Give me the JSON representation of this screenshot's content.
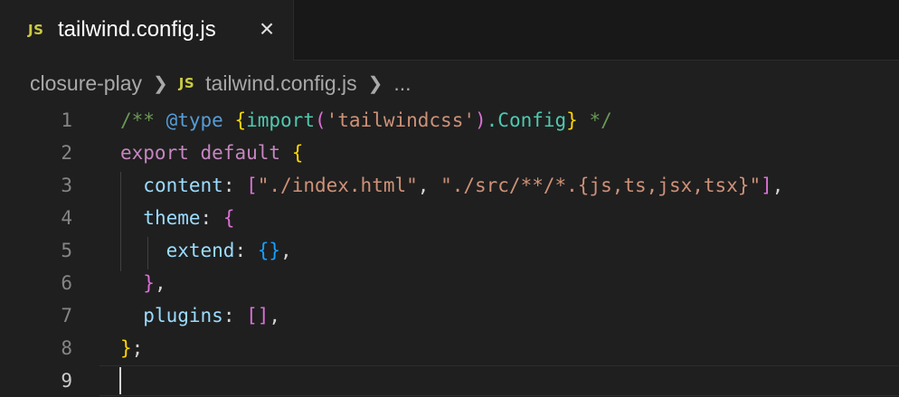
{
  "tab": {
    "icon": "JS",
    "label": "tailwind.config.js",
    "close": "×"
  },
  "breadcrumb": {
    "folder": "closure-play",
    "file_icon": "JS",
    "file": "tailwind.config.js",
    "more": "..."
  },
  "editor": {
    "line_numbers": [
      "1",
      "2",
      "3",
      "4",
      "5",
      "6",
      "7",
      "8",
      "9"
    ],
    "lines": [
      [
        {
          "t": "/** ",
          "c": "comment"
        },
        {
          "t": "@type",
          "c": "tag"
        },
        {
          "t": " ",
          "c": "comment"
        },
        {
          "t": "{",
          "c": "br1"
        },
        {
          "t": "import",
          "c": "type"
        },
        {
          "t": "(",
          "c": "br2"
        },
        {
          "t": "'tailwindcss'",
          "c": "str"
        },
        {
          "t": ")",
          "c": "br2"
        },
        {
          "t": ".Config",
          "c": "type"
        },
        {
          "t": "}",
          "c": "br1"
        },
        {
          "t": " */",
          "c": "comment"
        }
      ],
      [
        {
          "t": "export",
          "c": "kw"
        },
        {
          "t": " ",
          "c": "punc"
        },
        {
          "t": "default",
          "c": "kw"
        },
        {
          "t": " ",
          "c": "punc"
        },
        {
          "t": "{",
          "c": "br1"
        }
      ],
      [
        {
          "t": "  ",
          "c": "punc"
        },
        {
          "t": "content",
          "c": "prop"
        },
        {
          "t": ": ",
          "c": "punc"
        },
        {
          "t": "[",
          "c": "br2"
        },
        {
          "t": "\"./index.html\"",
          "c": "str"
        },
        {
          "t": ", ",
          "c": "punc"
        },
        {
          "t": "\"./src/**/*.{js,ts,jsx,tsx}\"",
          "c": "str"
        },
        {
          "t": "]",
          "c": "br2"
        },
        {
          "t": ",",
          "c": "punc"
        }
      ],
      [
        {
          "t": "  ",
          "c": "punc"
        },
        {
          "t": "theme",
          "c": "prop"
        },
        {
          "t": ": ",
          "c": "punc"
        },
        {
          "t": "{",
          "c": "br2"
        }
      ],
      [
        {
          "t": "    ",
          "c": "punc"
        },
        {
          "t": "extend",
          "c": "prop"
        },
        {
          "t": ": ",
          "c": "punc"
        },
        {
          "t": "{}",
          "c": "br3"
        },
        {
          "t": ",",
          "c": "punc"
        }
      ],
      [
        {
          "t": "  ",
          "c": "punc"
        },
        {
          "t": "}",
          "c": "br2"
        },
        {
          "t": ",",
          "c": "punc"
        }
      ],
      [
        {
          "t": "  ",
          "c": "punc"
        },
        {
          "t": "plugins",
          "c": "prop"
        },
        {
          "t": ": ",
          "c": "punc"
        },
        {
          "t": "[]",
          "c": "br2"
        },
        {
          "t": ",",
          "c": "punc"
        }
      ],
      [
        {
          "t": "}",
          "c": "br1"
        },
        {
          "t": ";",
          "c": "punc"
        }
      ],
      []
    ],
    "active_line": 9
  }
}
